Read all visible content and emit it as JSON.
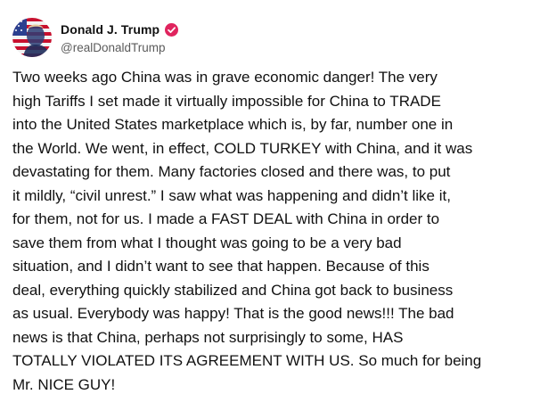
{
  "author": {
    "display_name": "Donald J. Trump",
    "handle": "@realDonaldTrump",
    "verified": true,
    "verified_color": "#e0245e",
    "avatar_icon": "avatar-flag-portrait"
  },
  "post": {
    "text": "Two weeks ago China was in grave economic danger! The very\nhigh Tariffs I set made it virtually impossible for China to TRADE\ninto the United States marketplace which is, by far, number one in\nthe World. We went, in effect, COLD TURKEY with China, and it was\ndevastating for them. Many factories closed and there was, to put\nit mildly, “civil unrest.” I saw what was happening and didn’t like it,\nfor them, not for us. I made a FAST DEAL with China in order to\nsave them from what I thought was going to be a very bad\nsituation, and I didn’t want to see that happen. Because of this\ndeal, everything quickly stabilized and China got back to business\nas usual. Everybody was happy! That is the good news!!! The bad\nnews is that China, perhaps not surprisingly to some, HAS\nTOTALLY VIOLATED ITS AGREEMENT WITH US. So much for being\nMr. NICE GUY!"
  }
}
